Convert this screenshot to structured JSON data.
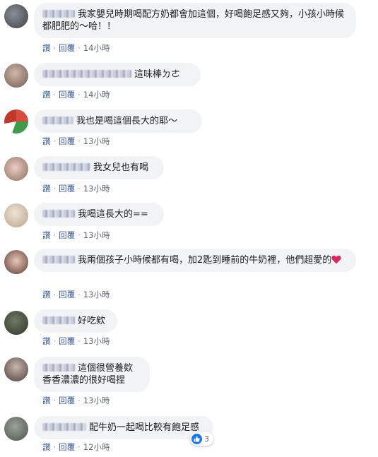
{
  "actions": {
    "like": "讚",
    "reply": "回覆"
  },
  "comments": [
    {
      "text": "我家嬰兒時期喝配方奶都會加這個，好喝飽足感又夠，小孩小時候都肥肥的～哈！！",
      "time": "14小時"
    },
    {
      "text": "這味棒ㄉㄜ",
      "time": "14小時"
    },
    {
      "text": "我也是喝這個長大的耶～",
      "time": "13小時"
    },
    {
      "text": "我女兒也有喝",
      "time": "13小時"
    },
    {
      "text": "我喝這長大的==",
      "time": "13小時"
    },
    {
      "text": "我兩個孩子小時候都有喝，加2匙到睡前的牛奶裡，他們超愛的",
      "time": "13小時"
    },
    {
      "text": "好吃欸",
      "time": "13小時"
    },
    {
      "text": "這個很營養欸 香香濃濃的很好喝捏",
      "time": "13小時"
    },
    {
      "text": "配牛奶一起喝比較有飽足感",
      "time": "12小時",
      "reaction_count": "3"
    }
  ],
  "colors": {
    "bubble": "#f2f3f5",
    "link": "#385898",
    "meta": "#616770",
    "like_blue": "#1877f2",
    "heart_red": "#e0245e"
  },
  "icons": {
    "heart": "heart-icon",
    "like": "thumbs-up-icon"
  }
}
